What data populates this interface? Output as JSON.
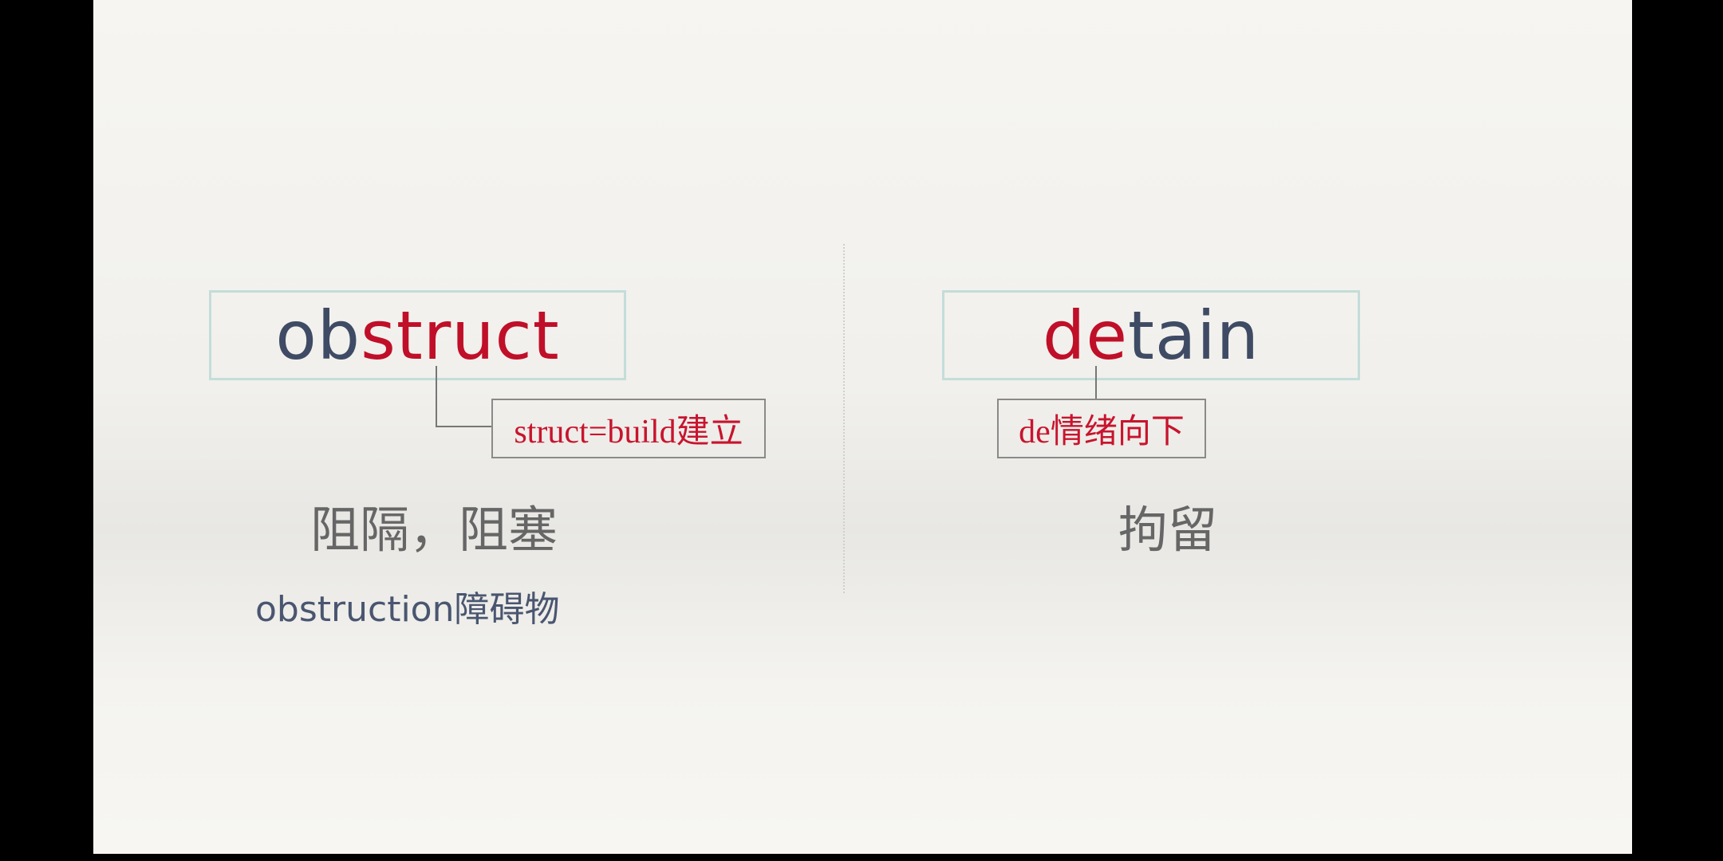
{
  "left": {
    "word_prefix": "ob",
    "word_root": "struct",
    "note": "struct=build建立",
    "meaning": "阻隔，阻塞",
    "derivative": "obstruction障碍物"
  },
  "right": {
    "word_prefix": "de",
    "word_root": "tain",
    "note": "de情绪向下",
    "meaning": "拘留"
  },
  "colors": {
    "highlight": "#c00f28",
    "base": "#3f4b64"
  }
}
